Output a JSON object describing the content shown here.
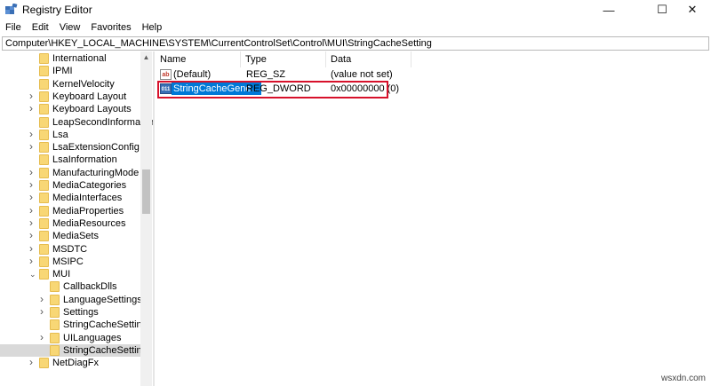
{
  "window": {
    "title": "Registry Editor",
    "controls": {
      "minimize": "—",
      "maximize": "☐",
      "close": "✕"
    }
  },
  "menu": [
    "File",
    "Edit",
    "View",
    "Favorites",
    "Help"
  ],
  "address": "Computer\\HKEY_LOCAL_MACHINE\\SYSTEM\\CurrentControlSet\\Control\\MUI\\StringCacheSetting",
  "tree": [
    {
      "label": "International",
      "expander": false,
      "depth": 0
    },
    {
      "label": "IPMI",
      "expander": false,
      "depth": 0
    },
    {
      "label": "KernelVelocity",
      "expander": false,
      "depth": 0
    },
    {
      "label": "Keyboard Layout",
      "expander": true,
      "depth": 0
    },
    {
      "label": "Keyboard Layouts",
      "expander": true,
      "depth": 0
    },
    {
      "label": "LeapSecondInformation",
      "expander": false,
      "depth": 0
    },
    {
      "label": "Lsa",
      "expander": true,
      "depth": 0
    },
    {
      "label": "LsaExtensionConfig",
      "expander": true,
      "depth": 0
    },
    {
      "label": "LsaInformation",
      "expander": false,
      "depth": 0
    },
    {
      "label": "ManufacturingMode",
      "expander": true,
      "depth": 0
    },
    {
      "label": "MediaCategories",
      "expander": true,
      "depth": 0
    },
    {
      "label": "MediaInterfaces",
      "expander": true,
      "depth": 0
    },
    {
      "label": "MediaProperties",
      "expander": true,
      "depth": 0
    },
    {
      "label": "MediaResources",
      "expander": true,
      "depth": 0
    },
    {
      "label": "MediaSets",
      "expander": true,
      "depth": 0
    },
    {
      "label": "MSDTC",
      "expander": true,
      "depth": 0
    },
    {
      "label": "MSIPC",
      "expander": true,
      "depth": 0
    },
    {
      "label": "MUI",
      "expander": "open",
      "depth": 0
    },
    {
      "label": "CallbackDlls",
      "expander": false,
      "depth": 1
    },
    {
      "label": "LanguageSettings",
      "expander": true,
      "depth": 1
    },
    {
      "label": "Settings",
      "expander": true,
      "depth": 1
    },
    {
      "label": "StringCacheSettings",
      "expander": false,
      "depth": 1
    },
    {
      "label": "UILanguages",
      "expander": true,
      "depth": 1
    },
    {
      "label": "StringCacheSetting",
      "expander": false,
      "depth": 1,
      "selected": true
    },
    {
      "label": "NetDiagFx",
      "expander": true,
      "depth": 0
    }
  ],
  "columns": [
    "Name",
    "Type",
    "Data"
  ],
  "values": [
    {
      "icon": "ab",
      "icon_name": "string-value-icon",
      "name": "(Default)",
      "type": "REG_SZ",
      "data": "(value not set)",
      "selected": false
    },
    {
      "icon": "011",
      "icon_name": "dword-value-icon",
      "name": "StringCacheGene...",
      "type": "REG_DWORD",
      "data": "0x00000000 (0)",
      "selected": true
    }
  ],
  "highlight_color": "#d7112b",
  "selection_color": "#0078d7",
  "watermark": "wsxdn.com"
}
